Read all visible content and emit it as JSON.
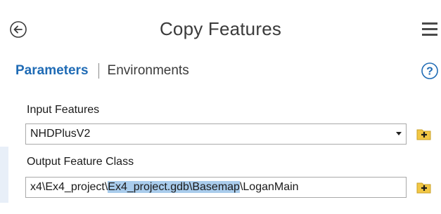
{
  "header": {
    "title": "Copy Features",
    "back_icon": "back-arrow-circle-icon",
    "menu_icon": "hamburger-menu-icon"
  },
  "tabs": {
    "parameters": "Parameters",
    "environments": "Environments",
    "active": "parameters",
    "help_icon": "help-icon"
  },
  "params": {
    "input_features": {
      "label": "Input Features",
      "value": "NHDPlusV2",
      "icon": "add-data-folder-icon"
    },
    "output_feature_class": {
      "label": "Output Feature Class",
      "value_prefix": "x4\\Ex4_project\\",
      "value_selected": "Ex4_project.gdb\\Basemap",
      "value_suffix": "\\LoganMain",
      "icon": "add-data-folder-icon"
    }
  },
  "colors": {
    "accent": "#1f6bb5",
    "selection": "#a9ccec",
    "folder": "#f2c744"
  }
}
